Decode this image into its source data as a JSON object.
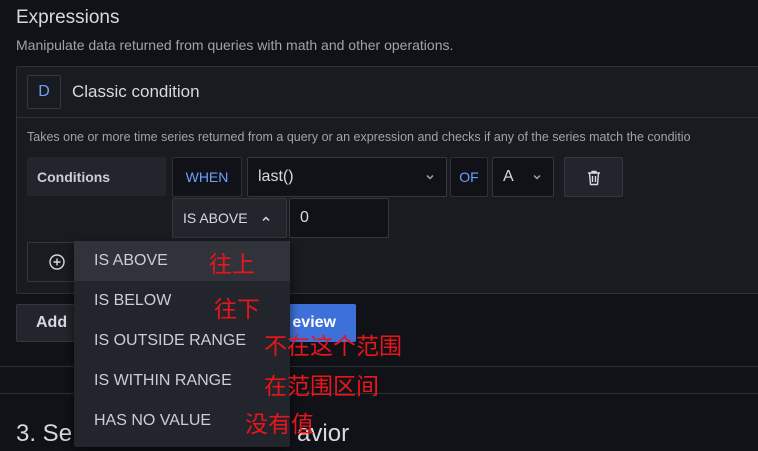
{
  "header": {
    "title": "Expressions",
    "subtitle": "Manipulate data returned from queries with math and other operations."
  },
  "expression": {
    "letter": "D",
    "title": "Classic condition",
    "description": "Takes one or more time series returned from a query or an expression and checks if any of the series match the conditio"
  },
  "condition": {
    "label": "Conditions",
    "when_label": "WHEN",
    "reducer_value": "last()",
    "of_label": "OF",
    "query_ref": "A",
    "evaluator_value": "IS ABOVE",
    "threshold_value": "0"
  },
  "buttons": {
    "add_label": "Add",
    "preview_label": "eview"
  },
  "next_section": {
    "title_prefix": "3. Se",
    "title_suffix": "avior"
  },
  "dropdown": {
    "options": [
      "IS ABOVE",
      "IS BELOW",
      "IS OUTSIDE RANGE",
      "IS WITHIN RANGE",
      "HAS NO VALUE"
    ],
    "selected": "IS ABOVE"
  },
  "annotations": [
    "往上",
    "往下",
    "不在这个范围",
    "在范围区间",
    "没有值"
  ],
  "colors": {
    "background": "#111217",
    "panel": "#181b1f",
    "accent_blue": "#6e9fff",
    "primary_button": "#3d71d9",
    "annotation_red": "#e8161b"
  }
}
